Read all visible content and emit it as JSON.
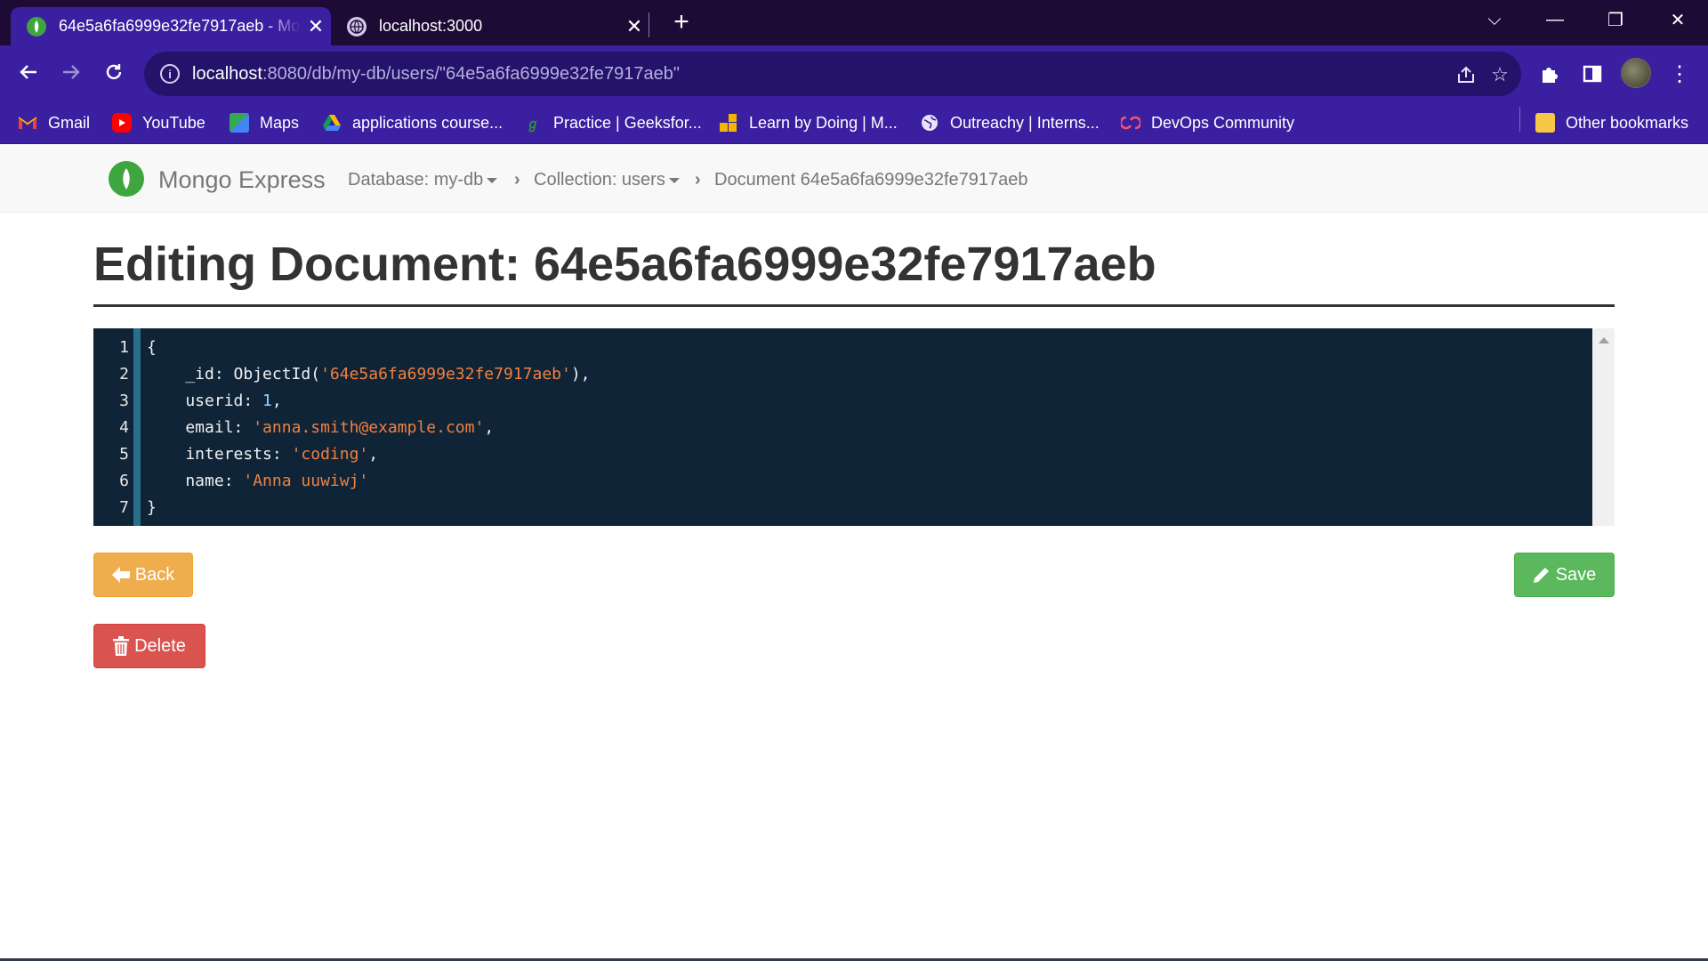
{
  "browser": {
    "tabs": [
      {
        "title": "64e5a6fa6999e32fe7917aeb - Mongo Express",
        "active": true,
        "close": "✕"
      },
      {
        "title": "localhost:3000",
        "active": false,
        "close": "✕"
      }
    ],
    "new_tab": "+",
    "window_controls": {
      "dropdown": "⌵",
      "minimize": "—",
      "restore": "❐",
      "close": "✕"
    },
    "url_host": "localhost",
    "url_rest": ":8080/db/my-db/users/\"64e5a6fa6999e32fe7917aeb\"",
    "bookmarks": [
      {
        "label": "Gmail",
        "icon": "gmail-icon"
      },
      {
        "label": "YouTube",
        "icon": "youtube-icon"
      },
      {
        "label": "Maps",
        "icon": "maps-icon"
      },
      {
        "label": "applications course...",
        "icon": "google-drive-icon"
      },
      {
        "label": "Practice | Geeksfor...",
        "icon": "geeksforgeeks-icon"
      },
      {
        "label": "Learn by Doing | M...",
        "icon": "learn-icon"
      },
      {
        "label": "Outreachy | Interns...",
        "icon": "globe-icon"
      },
      {
        "label": "DevOps Community",
        "icon": "devops-icon"
      }
    ],
    "other_bookmarks": "Other bookmarks"
  },
  "navbar": {
    "brand": "Mongo Express",
    "database": "Database: my-db",
    "collection": "Collection: users",
    "document": "Document 64e5a6fa6999e32fe7917aeb"
  },
  "page": {
    "title": "Editing Document: 64e5a6fa6999e32fe7917aeb"
  },
  "editor": {
    "line_numbers": [
      "1",
      "2",
      "3",
      "4",
      "5",
      "6",
      "7"
    ],
    "open_brace": "{",
    "close_brace": "}",
    "id_key": "    _id: ObjectId(",
    "id_value": "'64e5a6fa6999e32fe7917aeb'",
    "id_tail": "),",
    "userid_key": "    userid: ",
    "userid_value": "1",
    "userid_tail": ",",
    "email_key": "    email: ",
    "email_value": "'anna.smith@example.com'",
    "email_tail": ",",
    "interests_key": "    interests: ",
    "interests_value": "'coding'",
    "interests_tail": ",",
    "name_key": "    name: ",
    "name_value": "'Anna uuwiwj'"
  },
  "buttons": {
    "back": "Back",
    "save": "Save",
    "delete": "Delete"
  },
  "colors": {
    "back": "#f0ad4e",
    "save": "#5cb85c",
    "delete": "#d9534f",
    "editor_bg": "#0f2437",
    "string": "#f08040"
  }
}
